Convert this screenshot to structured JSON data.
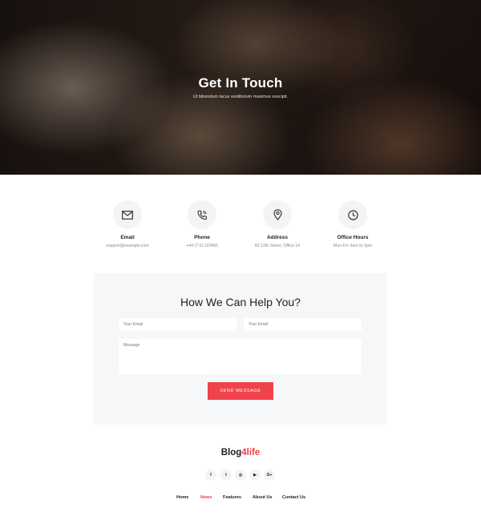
{
  "hero": {
    "title": "Get In Touch",
    "subtitle": "Ut bibendum lacus vestibulum maximus suscipit."
  },
  "contact_info": [
    {
      "icon": "envelope-icon",
      "title": "Email",
      "value": "support@example.com"
    },
    {
      "icon": "phone-icon",
      "title": "Phone",
      "value": "+44 (7 0) 123456"
    },
    {
      "icon": "location-pin-icon",
      "title": "Address",
      "value": "82 12th Street, Office 14"
    },
    {
      "icon": "clock-icon",
      "title": "Office Hours",
      "value": "Mon-Fri: 9am to 5pm"
    }
  ],
  "form": {
    "title": "How We Can Help You?",
    "email_placeholder_1": "Your Email",
    "email_placeholder_2": "Your Email",
    "message_placeholder": "Message",
    "send_label": "SEND MESSAGE"
  },
  "footer": {
    "logo_main": "Blog",
    "logo_accent": "4life",
    "socials": [
      {
        "name": "facebook-icon",
        "glyph": "f"
      },
      {
        "name": "twitter-icon",
        "glyph": "t"
      },
      {
        "name": "instagram-icon",
        "glyph": "◎"
      },
      {
        "name": "youtube-icon",
        "glyph": "▶"
      },
      {
        "name": "google-plus-icon",
        "glyph": "G+"
      }
    ],
    "nav": [
      {
        "label": "Home",
        "active": false
      },
      {
        "label": "News",
        "active": true
      },
      {
        "label": "Features",
        "active": false
      },
      {
        "label": "About Us",
        "active": false
      },
      {
        "label": "Contact Us",
        "active": false
      }
    ]
  },
  "colors": {
    "accent": "#f0424a",
    "panel_bg": "#f6f7f9",
    "icon_circle_bg": "#f3f4f6"
  }
}
